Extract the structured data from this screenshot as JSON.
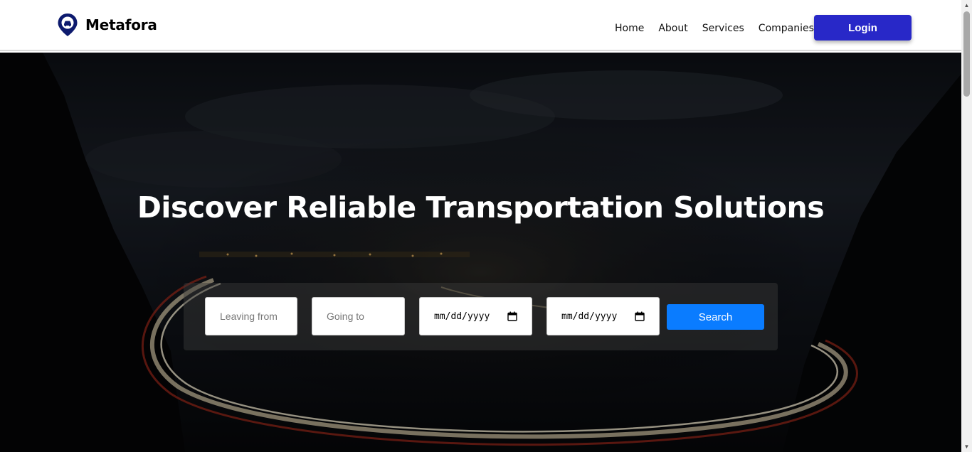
{
  "brand": {
    "name": "Metafora",
    "icon": "map-pin-car-icon",
    "color": "#0d1a6e"
  },
  "nav": {
    "items": [
      "Home",
      "About",
      "Services",
      "Companies"
    ],
    "login_label": "Login",
    "login_color": "#2828c8"
  },
  "hero": {
    "title": "Discover Reliable Transportation Solutions",
    "background": "night-highway-long-exposure"
  },
  "search": {
    "leaving_placeholder": "Leaving from",
    "going_placeholder": "Going to",
    "date1_placeholder": "mm/dd/yyyy",
    "date2_placeholder": "mm/dd/yyyy",
    "calendar_icon": "calendar-icon",
    "button_label": "Search",
    "button_color": "#0a7cff"
  }
}
